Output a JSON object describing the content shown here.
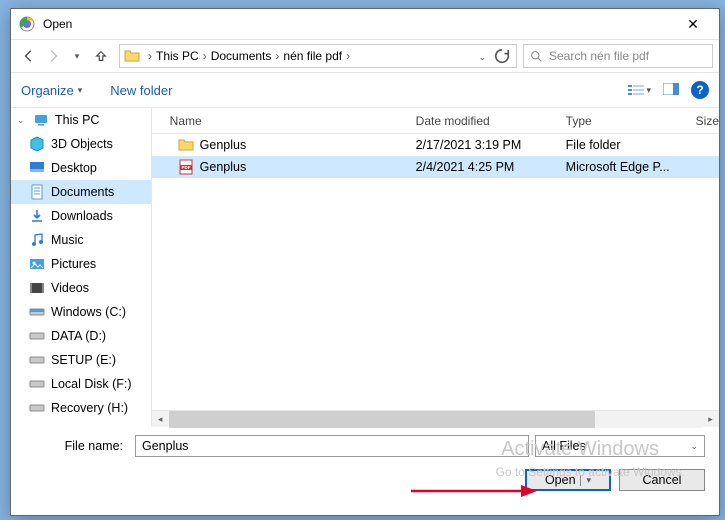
{
  "title": "Open",
  "breadcrumb": {
    "root": "This PC",
    "a": "Documents",
    "b": "nén file pdf"
  },
  "search_placeholder": "Search nén file pdf",
  "toolbar": {
    "organize": "Organize",
    "newfolder": "New folder"
  },
  "columns": {
    "name": "Name",
    "date": "Date modified",
    "type": "Type",
    "size": "Size"
  },
  "sidebar": {
    "root": "This PC",
    "items": [
      {
        "label": "3D Objects"
      },
      {
        "label": "Desktop"
      },
      {
        "label": "Documents"
      },
      {
        "label": "Downloads"
      },
      {
        "label": "Music"
      },
      {
        "label": "Pictures"
      },
      {
        "label": "Videos"
      },
      {
        "label": "Windows (C:)"
      },
      {
        "label": "DATA (D:)"
      },
      {
        "label": "SETUP (E:)"
      },
      {
        "label": "Local Disk (F:)"
      },
      {
        "label": "Recovery (H:)"
      }
    ]
  },
  "files": [
    {
      "name": "Genplus",
      "date": "2/17/2021 3:19 PM",
      "type": "File folder",
      "kind": "folder"
    },
    {
      "name": "Genplus",
      "date": "2/4/2021 4:25 PM",
      "type": "Microsoft Edge P...",
      "kind": "pdf"
    }
  ],
  "filename_label": "File name:",
  "filename_value": "Genplus",
  "filter_label": "All Files",
  "open_label": "Open",
  "cancel_label": "Cancel",
  "watermark1": "Activate Windows",
  "watermark2": "Go to Settings to activate Windows."
}
